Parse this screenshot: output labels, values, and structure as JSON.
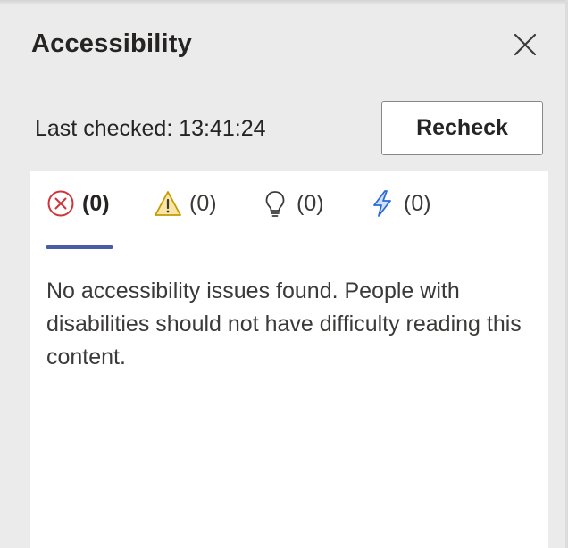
{
  "pane": {
    "title": "Accessibility",
    "close_label": "Close"
  },
  "status": {
    "last_checked": "Last checked: 13:41:24"
  },
  "toolbar": {
    "recheck_label": "Recheck"
  },
  "tabs": [
    {
      "icon": "error-circle-icon",
      "count": "(0)",
      "active": true
    },
    {
      "icon": "warning-triangle-icon",
      "count": "(0)",
      "active": false
    },
    {
      "icon": "lightbulb-icon",
      "count": "(0)",
      "active": false
    },
    {
      "icon": "lightning-icon",
      "count": "(0)",
      "active": false
    }
  ],
  "results": {
    "message": "No accessibility issues found. People with disabilities should not have difficulty reading this content."
  },
  "colors": {
    "error": "#d13438",
    "warning": "#c19c00",
    "tip": "#3b3a39",
    "intelligent": "#2b6bd6",
    "tab_indicator": "#4a5ba8"
  }
}
